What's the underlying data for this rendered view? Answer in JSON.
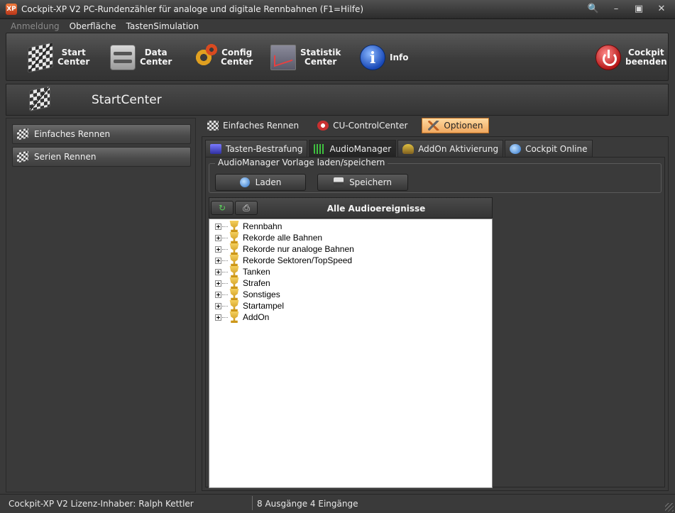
{
  "window": {
    "title": "Cockpit-XP V2 PC-Rundenzähler für analoge und digitale Rennbahnen (F1=Hilfe)",
    "app_icon_text": "XP"
  },
  "menu": {
    "items": [
      {
        "label": "Anmeldung",
        "enabled": false
      },
      {
        "label": "Oberfläche",
        "enabled": true
      },
      {
        "label": "TastenSimulation",
        "enabled": true
      }
    ]
  },
  "toolbar": {
    "start": "Start\nCenter",
    "data": "Data\nCenter",
    "config": "Config\nCenter",
    "statistik": "Statistik\nCenter",
    "info": "Info",
    "exit": "Cockpit\nbeenden"
  },
  "page": {
    "title": "StartCenter"
  },
  "sidebar": {
    "items": [
      {
        "label": "Einfaches Rennen"
      },
      {
        "label": "Serien Rennen"
      }
    ]
  },
  "top_tabs": [
    {
      "label": "Einfaches Rennen",
      "active": false
    },
    {
      "label": "CU-ControlCenter",
      "active": false
    },
    {
      "label": "Optionen",
      "active": true
    }
  ],
  "sub_tabs": [
    {
      "label": "Tasten-Bestrafung",
      "active": false
    },
    {
      "label": "AudioManager",
      "active": true
    },
    {
      "label": "AddOn Aktivierung",
      "active": false
    },
    {
      "label": "Cockpit Online",
      "active": false
    }
  ],
  "template_group": {
    "title": "AudioManager Vorlage laden/speichern",
    "load_label": "Laden",
    "save_label": "Speichern"
  },
  "tree": {
    "header": "Alle Audioereignisse",
    "items": [
      "Rennbahn",
      "Rekorde alle Bahnen",
      "Rekorde nur analoge Bahnen",
      "Rekorde Sektoren/TopSpeed",
      "Tanken",
      "Strafen",
      "Sonstiges",
      "Startampel",
      "AddOn"
    ]
  },
  "status": {
    "license": "Cockpit-XP V2 Lizenz-Inhaber: Ralph Kettler",
    "io": "8 Ausgänge 4 Eingänge"
  },
  "colors": {
    "accent_tab": "#f0a860",
    "background": "#3a3a3a"
  }
}
